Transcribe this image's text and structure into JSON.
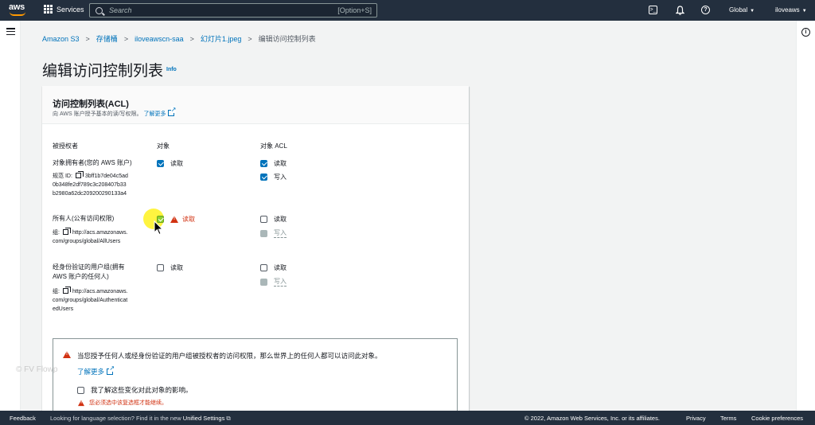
{
  "topnav": {
    "logo_text": "aws",
    "services_label": "Services",
    "search_placeholder": "Search",
    "search_shortcut": "[Option+S]",
    "cloudshell_glyph": ">_",
    "help_glyph": "?",
    "region_label": "Global",
    "user_label": "iloveaws"
  },
  "breadcrumb": {
    "items": [
      "Amazon S3",
      "存储桶",
      "iloveawscn-saa",
      "幻灯片1.jpeg",
      "编辑访问控制列表"
    ]
  },
  "page": {
    "title": "编辑访问控制列表",
    "info": "Info"
  },
  "acl_panel": {
    "title": "访问控制列表(ACL)",
    "description": "向 AWS 账户授予基本的读/写权限。",
    "learn_more": "了解更多",
    "col_grantee": "被授权者",
    "col_object": "对象",
    "col_object_acl": "对象 ACL",
    "rows": {
      "owner": {
        "name": "对象拥有者(您的 AWS 账户)",
        "id_label": "规范 ID:",
        "id_line1": "3bff1b7de04c5ad",
        "id_line2": "0b348fe2df789c3c208407b33",
        "id_line3": "b2980a62dc209200290133a4",
        "object_read": "读取",
        "acl_read": "读取",
        "acl_write": "写入"
      },
      "everyone": {
        "name": "所有人(公有访问权限)",
        "group_label": "组:",
        "uri_line1": "http://acs.amazonaws.",
        "uri_line2": "com/groups/global/AllUsers",
        "object_read": "读取",
        "acl_read": "读取",
        "acl_write": "写入"
      },
      "authenticated": {
        "name_line1": "经身份验证的用户组(拥有",
        "name_line2": "AWS 账户的任何人)",
        "group_label": "组:",
        "uri_line1": "http://acs.amazonaws.",
        "uri_line2": "com/groups/global/Authenticat",
        "uri_line3": "edUsers",
        "object_read": "读取",
        "acl_read": "读取",
        "acl_write": "写入"
      }
    }
  },
  "alert": {
    "text": "当您授予任何人或经身份验证的用户组被授权者的访问权限，那么世界上的任何人都可以访问此对象。",
    "learn_more": "了解更多",
    "acknowledge": "我了解这些变化对此对象的影响。",
    "error": "您必须选中该复选框才能继续。"
  },
  "watermark": "FV Flowp",
  "footer": {
    "feedback": "Feedback",
    "language_note": "Looking for language selection? Find it in the new",
    "unified_settings": "Unified Settings",
    "copyright": "© 2022, Amazon Web Services, Inc. or its affiliates.",
    "privacy": "Privacy",
    "terms": "Terms",
    "cookie": "Cookie preferences"
  },
  "colors": {
    "nav_bg": "#232f3e",
    "link": "#0073bb",
    "error": "#d13212",
    "checkbox": "#0073bb",
    "cursor_highlight": "#fff000"
  }
}
